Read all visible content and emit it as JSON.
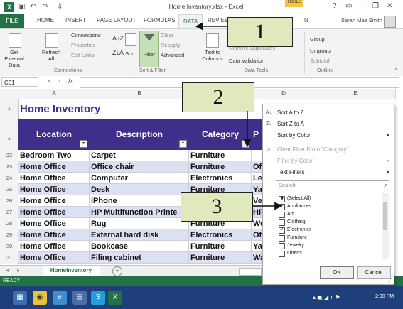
{
  "window": {
    "title": "Home Inventory.xlsx - Excel",
    "tools_badge": "TOOLS",
    "help": "?",
    "user": "Sarah Mae Smith"
  },
  "tabs": [
    {
      "label": "FILE"
    },
    {
      "label": "HOME"
    },
    {
      "label": "INSERT"
    },
    {
      "label": "PAGE LAYOUT"
    },
    {
      "label": "FORMULAS"
    },
    {
      "label": "DATA"
    },
    {
      "label": "REVIEW"
    },
    {
      "label": "N"
    }
  ],
  "ribbon": {
    "get_external": "Get External Data",
    "refresh": "Refresh All",
    "connections": "Connections",
    "properties": "Properties",
    "edit_links": "Edit Links",
    "group_connections": "Connections",
    "sort": "Sort",
    "filter": "Filter",
    "clear": "Clear",
    "reapply": "Reapply",
    "advanced": "Advanced",
    "group_sort": "Sort & Filter",
    "text_to_columns": "Text to Columns",
    "remove_duplicates": "Remove Duplicates",
    "data_validation": "Data Validation",
    "group_tools": "Data Tools",
    "outline_group": "Group",
    "outline_ungroup": "Ungroup",
    "outline_subtotal": "Subtotal",
    "group_outline": "Outline"
  },
  "formula_bar": {
    "name_box": "C61",
    "fx": "fx",
    "value": ""
  },
  "columns": [
    "A",
    "B",
    "C",
    "D",
    "E"
  ],
  "sheet": {
    "title": "Home Inventory",
    "headers": [
      "Location",
      "Description",
      "Category",
      "P"
    ],
    "rows": [
      {
        "n": "22",
        "loc": "Bedroom Two",
        "desc": "Carpet",
        "cat": "Furniture",
        "d": ""
      },
      {
        "n": "23",
        "loc": "Home Office",
        "desc": "Office chair",
        "cat": "Furniture",
        "d": "Of"
      },
      {
        "n": "24",
        "loc": "Home Office",
        "desc": "Computer",
        "cat": "Electronics",
        "d": "Le"
      },
      {
        "n": "25",
        "loc": "Home Office",
        "desc": "Desk",
        "cat": "Furniture",
        "d": "Ya"
      },
      {
        "n": "26",
        "loc": "Home Office",
        "desc": "iPhone",
        "cat": "",
        "d": "Ve"
      },
      {
        "n": "27",
        "loc": "Home Office",
        "desc": "HP Multifunction Printe",
        "cat": "",
        "d": "HP"
      },
      {
        "n": "28",
        "loc": "Home Office",
        "desc": "Rug",
        "cat": "Furniture",
        "d": "Wo"
      },
      {
        "n": "29",
        "loc": "Home Office",
        "desc": "External hard disk",
        "cat": "Electronics",
        "d": "Of"
      },
      {
        "n": "30",
        "loc": "Home Office",
        "desc": "Bookcase",
        "cat": "Furniture",
        "d": "Ya"
      },
      {
        "n": "31",
        "loc": "Home Office",
        "desc": "Filing cabinet",
        "cat": "Furniture",
        "d": "Wa"
      }
    ],
    "row_title_n": "1",
    "row_hdr_n": "2",
    "sheet_tab": "HomeInventory",
    "add_sheet": "+"
  },
  "dropdown": {
    "sort_az": "Sort A to Z",
    "sort_za": "Sort Z to A",
    "sort_color": "Sort by Color",
    "clear_filter": "Clear Filter From \"Category\"",
    "filter_color": "Filter by Color",
    "text_filters": "Text Filters",
    "search_placeholder": "Search",
    "items": [
      {
        "label": "(Select All)",
        "checked": "■"
      },
      {
        "label": "Appliances",
        "checked": "✔"
      },
      {
        "label": "Art",
        "checked": ""
      },
      {
        "label": "Clothing",
        "checked": ""
      },
      {
        "label": "Electronics",
        "checked": "✔"
      },
      {
        "label": "Furniture",
        "checked": ""
      },
      {
        "label": "Jewelry",
        "checked": ""
      },
      {
        "label": "Linens",
        "checked": ""
      }
    ],
    "ok": "OK",
    "cancel": "Cancel"
  },
  "callouts": {
    "one": "1",
    "two": "2",
    "three": "3"
  },
  "status": {
    "ready": "READY"
  },
  "taskbar": {
    "time": "2:00 PM"
  },
  "colors": {
    "accent": "#217346",
    "header": "#3f2e8a",
    "band": "#dbe0f3",
    "callout": "#dfe9bd"
  }
}
